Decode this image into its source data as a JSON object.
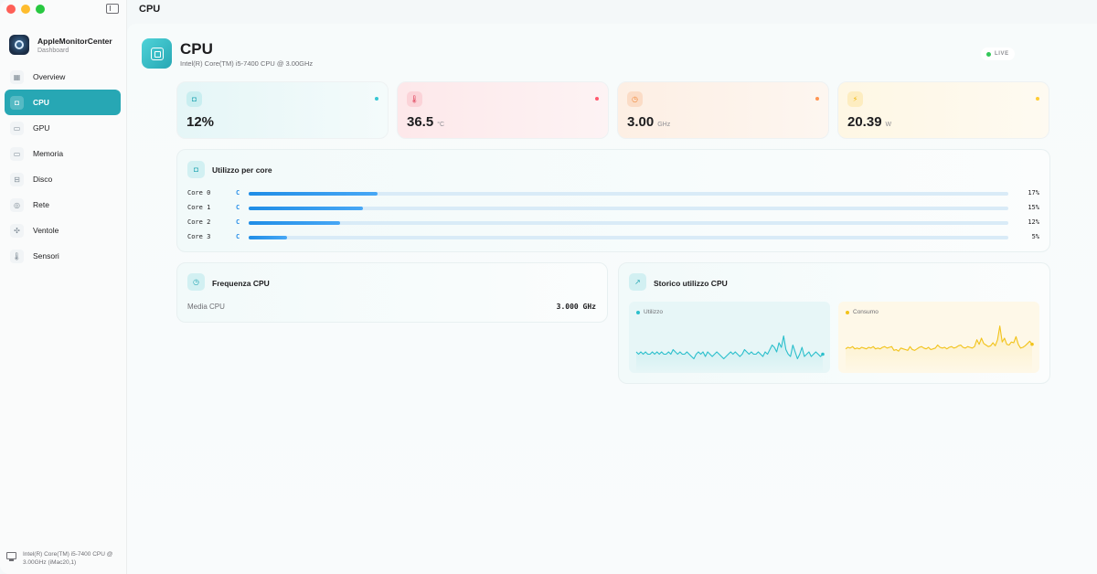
{
  "window": {
    "title": "CPU"
  },
  "app": {
    "name": "AppleMonitorCenter",
    "subtitle": "Dashboard"
  },
  "sidebar": {
    "items": [
      {
        "label": "Overview",
        "icon": "grid-icon",
        "glyph": "▦",
        "active": false
      },
      {
        "label": "CPU",
        "icon": "cpu-icon",
        "glyph": "◘",
        "active": true
      },
      {
        "label": "GPU",
        "icon": "display-icon",
        "glyph": "▭",
        "active": false
      },
      {
        "label": "Memoria",
        "icon": "memory-icon",
        "glyph": "▭",
        "active": false
      },
      {
        "label": "Disco",
        "icon": "disk-icon",
        "glyph": "⊟",
        "active": false
      },
      {
        "label": "Rete",
        "icon": "globe-icon",
        "glyph": "◎",
        "active": false
      },
      {
        "label": "Ventole",
        "icon": "fan-icon",
        "glyph": "✣",
        "active": false
      },
      {
        "label": "Sensori",
        "icon": "thermometer-icon",
        "glyph": "🌡",
        "active": false
      }
    ],
    "footer": "Intel(R) Core(TM) i5-7400 CPU @ 3.00GHz (iMac20,1)"
  },
  "header": {
    "title": "CPU",
    "subtitle": "Intel(R) Core(TM) i5-7400 CPU @ 3.00GHz",
    "badge": "LIVE"
  },
  "stats": [
    {
      "value": "12%",
      "unit": "",
      "icon": "cpu-icon",
      "color": "#27a7b4"
    },
    {
      "value": "36.5",
      "unit": "°C",
      "icon": "thermometer-icon",
      "color": "#e0425a"
    },
    {
      "value": "3.00",
      "unit": "GHz",
      "icon": "gauge-icon",
      "color": "#f08a3c"
    },
    {
      "value": "20.39",
      "unit": "W",
      "icon": "bolt-icon",
      "color": "#f2b400"
    }
  ],
  "cores": {
    "title": "Utilizzo per core",
    "items": [
      {
        "label": "Core 0",
        "type": "C",
        "percent": 17,
        "percent_label": "17%"
      },
      {
        "label": "Core 1",
        "type": "C",
        "percent": 15,
        "percent_label": "15%"
      },
      {
        "label": "Core 2",
        "type": "C",
        "percent": 12,
        "percent_label": "12%"
      },
      {
        "label": "Core 3",
        "type": "C",
        "percent": 5,
        "percent_label": "5%"
      }
    ]
  },
  "frequency": {
    "title": "Frequenza CPU",
    "label": "Media CPU",
    "value": "3.000 GHz"
  },
  "history": {
    "title": "Storico utilizzo CPU",
    "utilizzo_label": "Utilizzo",
    "consumo_label": "Consumo",
    "utilizzo_color": "#2bbfcc",
    "consumo_color": "#f2c31a",
    "utilizzo": [
      6,
      5,
      6,
      5,
      6,
      5,
      5,
      6,
      5,
      6,
      5,
      6,
      5,
      5,
      6,
      5,
      7,
      6,
      5,
      6,
      5,
      5,
      6,
      5,
      4,
      3,
      5,
      6,
      5,
      6,
      4,
      6,
      5,
      4,
      5,
      6,
      5,
      4,
      3,
      4,
      5,
      6,
      5,
      6,
      5,
      4,
      5,
      7,
      6,
      5,
      6,
      5,
      5,
      6,
      5,
      4,
      6,
      5,
      7,
      9,
      8,
      6,
      10,
      8,
      13,
      7,
      5,
      4,
      9,
      6,
      3,
      5,
      8,
      4,
      5,
      6,
      4,
      5,
      6,
      5,
      4,
      5
    ],
    "consumo": [
      22,
      24,
      23,
      25,
      22,
      23,
      22,
      24,
      23,
      22,
      24,
      23,
      25,
      22,
      23,
      22,
      24,
      25,
      23,
      24,
      25,
      20,
      21,
      19,
      23,
      22,
      21,
      20,
      25,
      21,
      20,
      22,
      24,
      25,
      23,
      22,
      24,
      21,
      22,
      23,
      27,
      24,
      23,
      24,
      22,
      24,
      25,
      23,
      24,
      26,
      27,
      24,
      23,
      25,
      24,
      23,
      25,
      34,
      28,
      36,
      29,
      27,
      25,
      26,
      30,
      26,
      34,
      52,
      31,
      36,
      28,
      27,
      31,
      30,
      38,
      28,
      23,
      24,
      26,
      29,
      32,
      28
    ]
  }
}
